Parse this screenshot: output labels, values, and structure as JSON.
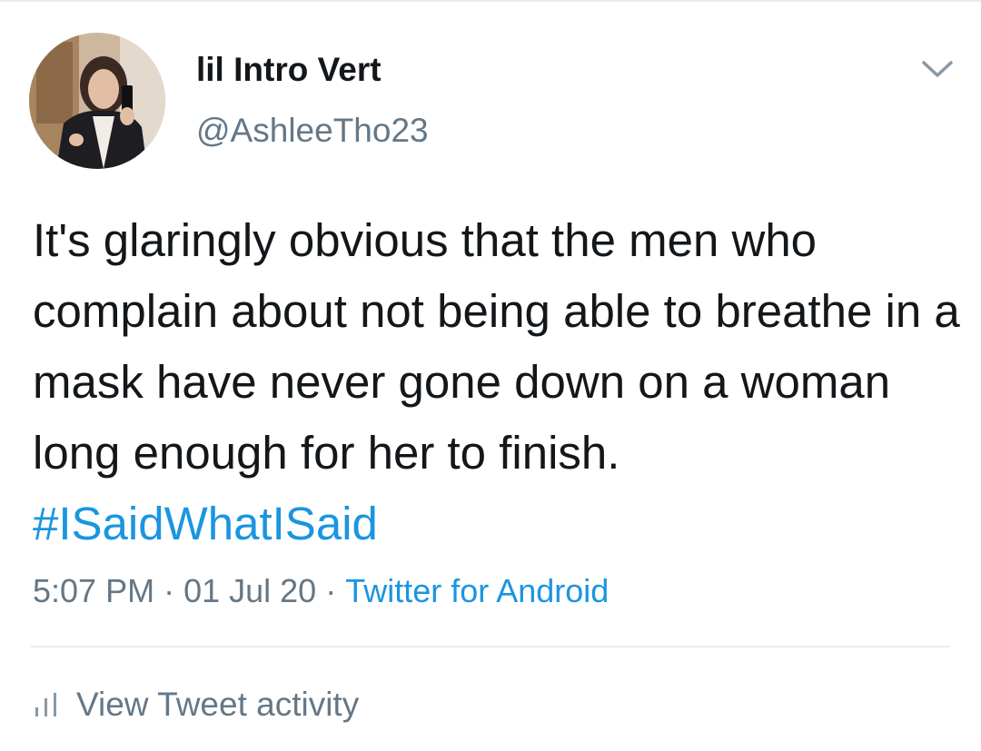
{
  "author": {
    "display_name": "lil Intro Vert",
    "handle": "@AshleeTho23",
    "avatar_icon": "profile-photo"
  },
  "tweet": {
    "text": "It's glaringly obvious that the men who complain about not being able to breathe in a mask have never gone down on a woman long enough for her to finish. ",
    "hashtag": "#ISaidWhatISaid"
  },
  "meta": {
    "time": "5:07 PM",
    "separator": "·",
    "date": "01 Jul 20",
    "source": "Twitter for Android"
  },
  "actions": {
    "view_activity": "View Tweet activity",
    "activity_icon": "bar-chart-icon",
    "menu_icon": "chevron-down-icon"
  },
  "colors": {
    "text": "#14171a",
    "secondary": "#657786",
    "link": "#1b95e0",
    "divider": "#e6ecf0"
  }
}
